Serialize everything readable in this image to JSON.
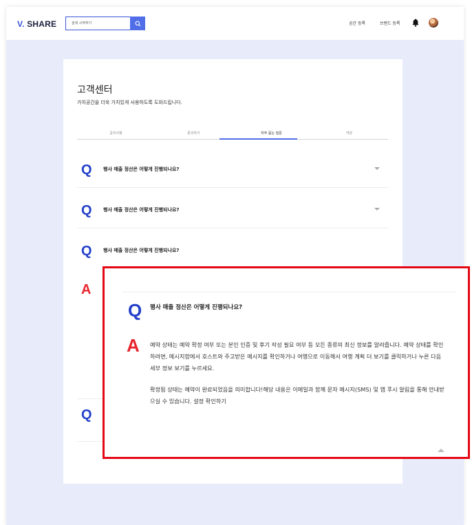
{
  "header": {
    "logo_prefix": "V.",
    "logo_suffix": "SHARE",
    "search_placeholder": "검색 시작하기",
    "nav": [
      "공간 등록",
      "브랜드 등록"
    ]
  },
  "page": {
    "title": "고객센터",
    "subtitle": "가치공간을 더욱 가치있게 사용하도록 도와드립니다.",
    "tabs": [
      "공지사항",
      "문의하기",
      "자주 묻는 질문",
      "약관"
    ],
    "active_tab": "자주 묻는 질문"
  },
  "faq": {
    "q_marker": "Q",
    "a_marker": "A",
    "items": [
      {
        "question": "행사 매출 정산은 어떻게 진행되나요?"
      },
      {
        "question": "행사 매출 정산은 어떻게 진행되나요?"
      },
      {
        "question": "행사 매출 정산은 어떻게 진행되나요?"
      }
    ]
  },
  "expanded": {
    "question": "행사 매출 정산은 어떻게 진행되나요?",
    "answer_p1": "예약 상태는 예약 확정 여부 또는 본인 인증 및 후기 작성 필요 여부 등 모든 종류의 최신 정보를 알려줍니다. 예약 상태를 확인하려면, 메시지함에서 호스트와 주고받은 메시지를 확인하거나 여행으로 이동해서 여행 계획 더 보기를 클릭하거나 누른 다음 세부 정보 보기를 누르세요.",
    "answer_p2": "확정됨 상태는 예약이 완료되었음을 의미합니다!해당 내용은 이메일과 함께 문자 메시지(SMS) 및 앱 푸시 알림을 통해 안내받으실 수 있습니다. 설정 확인하기"
  },
  "colors": {
    "brand": "#3a55d9",
    "q_marker": "#2340c9",
    "a_marker": "#e8252d",
    "highlight_border": "#e30613",
    "background": "#e8ebfa"
  },
  "icons": {
    "search": "search-icon",
    "bell": "bell-icon",
    "avatar": "avatar",
    "expand": "chevron-down-icon",
    "collapse": "chevron-up-icon"
  }
}
